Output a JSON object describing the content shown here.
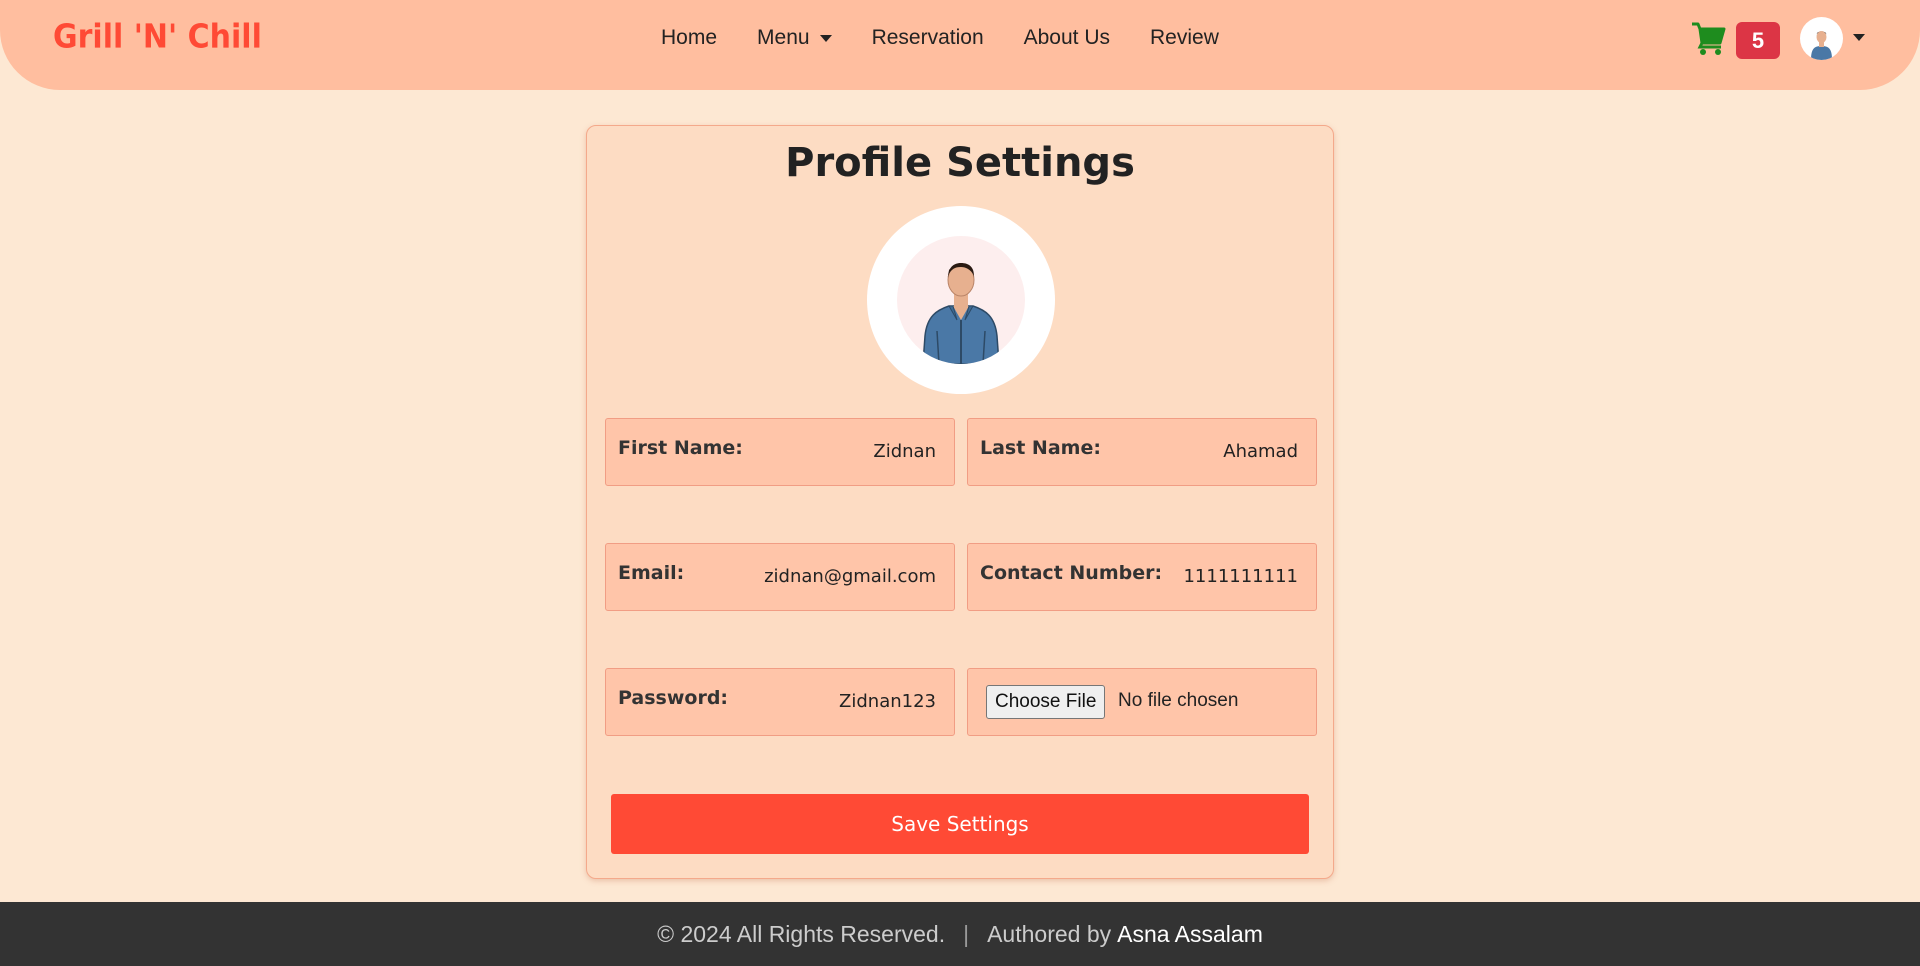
{
  "navbar": {
    "brand": "Grill 'N' Chill",
    "links": [
      {
        "label": "Home"
      },
      {
        "label": "Menu",
        "dropdown": true
      },
      {
        "label": "Reservation"
      },
      {
        "label": "About Us"
      },
      {
        "label": "Review"
      }
    ],
    "cart_count": "5",
    "cart_icon": "cart-icon",
    "avatar_icon": "user-avatar"
  },
  "profile": {
    "title": "Profile Settings",
    "first_name_label": "First Name:",
    "first_name_value": "Zidnan",
    "last_name_label": "Last Name:",
    "last_name_value": "Ahamad",
    "email_label": "Email:",
    "email_value": "zidnan@gmail.com",
    "contact_label": "Contact Number:",
    "contact_value": "1111111111",
    "password_label": "Password:",
    "password_value": "Zidnan123",
    "file_button": "Choose File",
    "file_status": "No file chosen",
    "save_button": "Save Settings"
  },
  "footer": {
    "copyright": "© 2024 All Rights Reserved.",
    "separator": "|",
    "authored_by": "Authored by",
    "author": "Asna Assalam"
  },
  "colors": {
    "navbar_bg": "#ffbe9f",
    "page_bg": "#fde8d3",
    "brand": "#ff4a35",
    "accent": "#ff4a35",
    "badge": "#dc3545",
    "cart": "#1e8c1e",
    "footer_bg": "#333333"
  }
}
